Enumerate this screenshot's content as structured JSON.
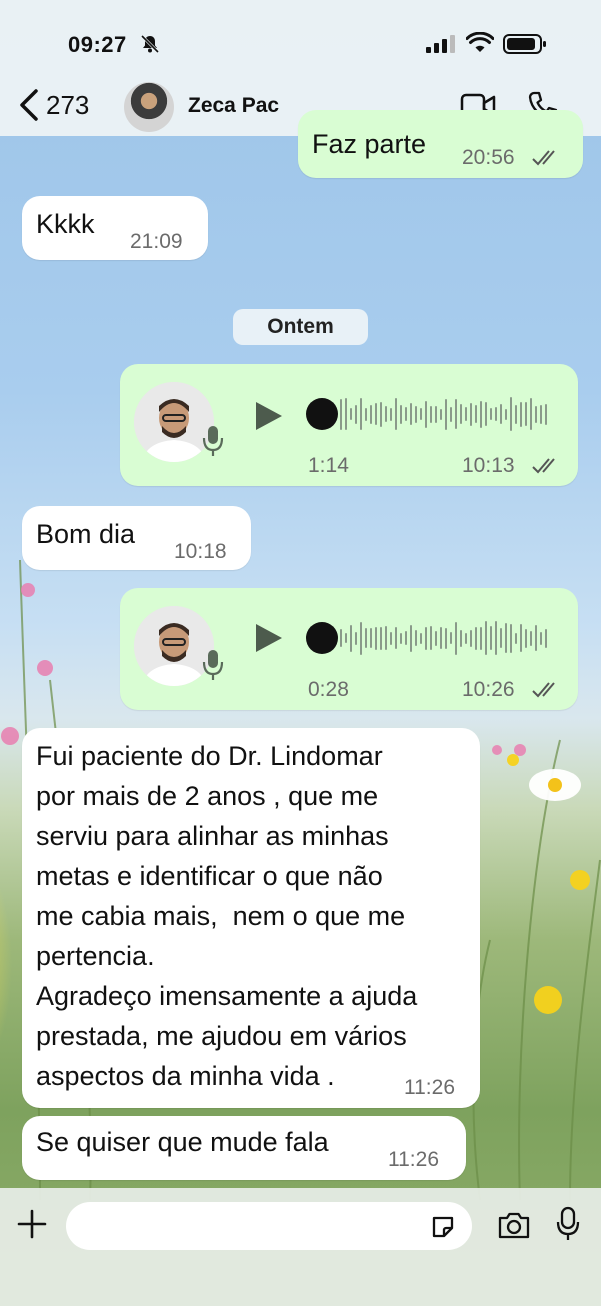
{
  "status": {
    "time": "09:27"
  },
  "header": {
    "back_count": "273",
    "contact_name": "Zeca Pac"
  },
  "messages": [
    {
      "text": "Faz parte",
      "time": "20:56",
      "direction": "out"
    },
    {
      "text": "Kkkk",
      "time": "21:09",
      "direction": "in"
    },
    {
      "day_separator": "Ontem"
    },
    {
      "type": "voice",
      "duration": "1:14",
      "time": "10:13",
      "direction": "out"
    },
    {
      "text": "Bom dia",
      "time": "10:18",
      "direction": "in"
    },
    {
      "type": "voice",
      "duration": "0:28",
      "time": "10:26",
      "direction": "out"
    },
    {
      "lines": [
        "Fui paciente do Dr. Lindomar",
        "por mais de 2 anos , que me",
        "serviu para alinhar as minhas",
        "metas e identificar o que não",
        "me cabia mais,  nem o que me",
        "pertencia.",
        "Agradeço imensamente a ajuda",
        "prestada, me ajudou em vários",
        "aspectos da minha vida ."
      ],
      "time": "11:26",
      "direction": "in"
    },
    {
      "text": "Se quiser que mude fala",
      "time": "11:26",
      "direction": "in"
    }
  ],
  "composer": {
    "placeholder": ""
  },
  "colors": {
    "outgoing_bubble": "#d9fdd3",
    "incoming_bubble": "#ffffff",
    "read_ticks": "#555555"
  },
  "icons": [
    "bell-slash-icon",
    "signal-icon",
    "wifi-icon",
    "battery-icon",
    "chevron-left-icon",
    "video-call-icon",
    "phone-icon",
    "play-icon",
    "microphone-icon",
    "plus-icon",
    "sticker-icon",
    "camera-icon"
  ]
}
